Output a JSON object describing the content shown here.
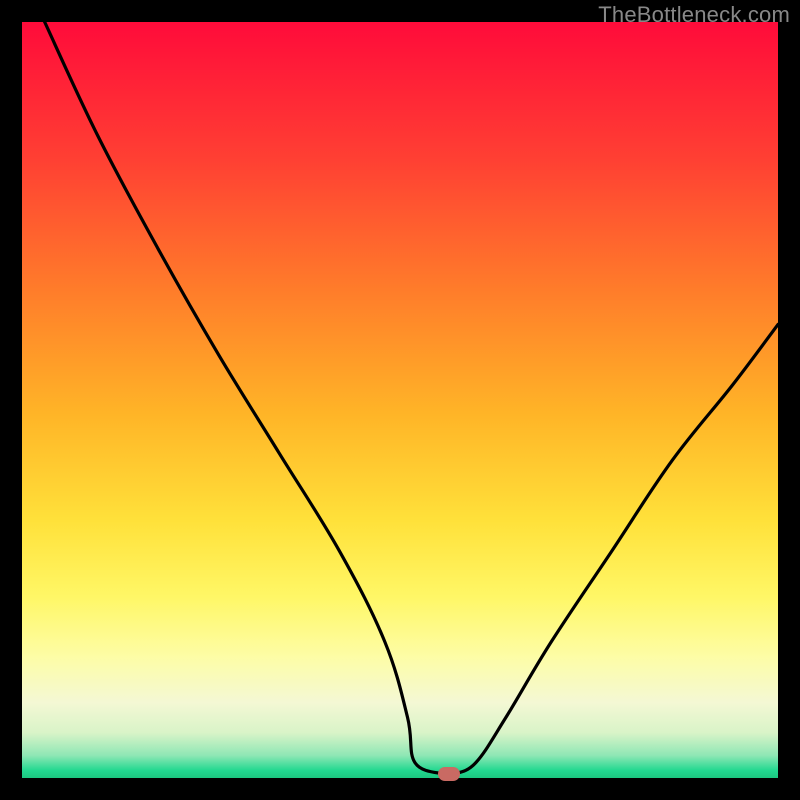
{
  "watermark": "TheBottleneck.com",
  "chart_data": {
    "type": "line",
    "title": "",
    "xlabel": "",
    "ylabel": "",
    "xlim": [
      0,
      100
    ],
    "ylim": [
      0,
      100
    ],
    "grid": false,
    "legend": false,
    "series": [
      {
        "name": "curve",
        "x": [
          3,
          10,
          18,
          26,
          34,
          42,
          48,
          51,
          52,
          56,
          57,
          60,
          64,
          70,
          78,
          86,
          94,
          100
        ],
        "y": [
          100,
          85,
          70,
          56,
          43,
          30,
          18,
          8,
          2,
          0.5,
          0.5,
          2,
          8,
          18,
          30,
          42,
          52,
          60
        ]
      }
    ],
    "marker": {
      "x": 56.5,
      "y": 0.5,
      "color": "#c96a63"
    },
    "background_gradient": {
      "top": "#ff0b3a",
      "bottom": "#1cc780"
    }
  }
}
